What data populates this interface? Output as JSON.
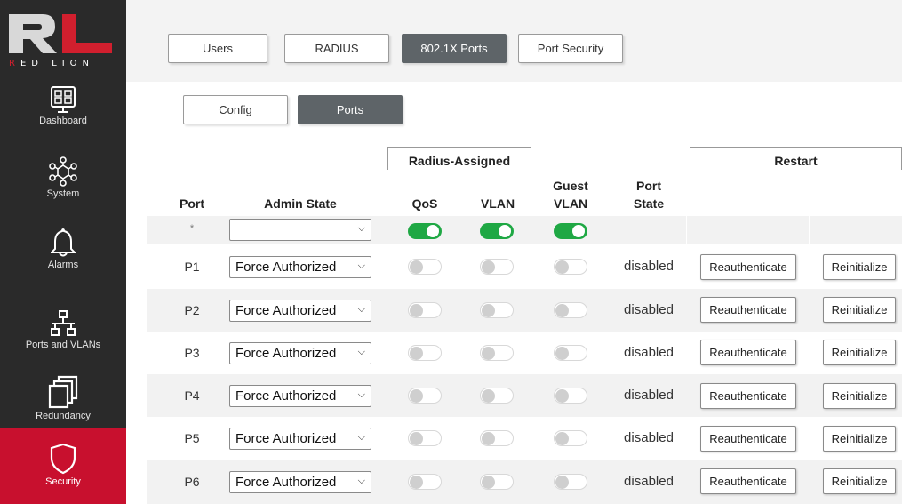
{
  "brand": {
    "logo_text": "RED LION",
    "accent": "#c8102e"
  },
  "sidebar": {
    "items": [
      {
        "label": "Dashboard",
        "icon": "dashboard-icon"
      },
      {
        "label": "System",
        "icon": "system-icon"
      },
      {
        "label": "Alarms",
        "icon": "bell-icon"
      },
      {
        "label": "Ports and VLANs",
        "icon": "network-icon"
      },
      {
        "label": "Redundancy",
        "icon": "redundancy-icon"
      },
      {
        "label": "Security",
        "icon": "shield-icon",
        "active": true
      }
    ]
  },
  "tabs": [
    {
      "label": "Users"
    },
    {
      "label": "RADIUS"
    },
    {
      "label": "802.1X Ports",
      "active": true
    },
    {
      "label": "Port Security"
    }
  ],
  "subtabs": [
    {
      "label": "Config"
    },
    {
      "label": "Ports",
      "active": true
    }
  ],
  "table": {
    "group_radius": "Radius-Assigned",
    "group_restart": "Restart",
    "columns": {
      "port": "Port",
      "admin_state": "Admin State",
      "qos": "QoS",
      "vlan": "VLAN",
      "guest_vlan_1": "Guest",
      "guest_vlan_2": "VLAN",
      "port_state_1": "Port",
      "port_state_2": "State"
    },
    "all_row": {
      "port": "*",
      "admin_state": "",
      "qos": true,
      "vlan": true,
      "guest_vlan": true
    },
    "rows": [
      {
        "port": "P1",
        "admin_state": "Force Authorized",
        "qos": false,
        "vlan": false,
        "guest_vlan": false,
        "state": "disabled",
        "reauth": "Reauthenticate",
        "reinit": "Reinitialize"
      },
      {
        "port": "P2",
        "admin_state": "Force Authorized",
        "qos": false,
        "vlan": false,
        "guest_vlan": false,
        "state": "disabled",
        "reauth": "Reauthenticate",
        "reinit": "Reinitialize"
      },
      {
        "port": "P3",
        "admin_state": "Force Authorized",
        "qos": false,
        "vlan": false,
        "guest_vlan": false,
        "state": "disabled",
        "reauth": "Reauthenticate",
        "reinit": "Reinitialize"
      },
      {
        "port": "P4",
        "admin_state": "Force Authorized",
        "qos": false,
        "vlan": false,
        "guest_vlan": false,
        "state": "disabled",
        "reauth": "Reauthenticate",
        "reinit": "Reinitialize"
      },
      {
        "port": "P5",
        "admin_state": "Force Authorized",
        "qos": false,
        "vlan": false,
        "guest_vlan": false,
        "state": "disabled",
        "reauth": "Reauthenticate",
        "reinit": "Reinitialize"
      },
      {
        "port": "P6",
        "admin_state": "Force Authorized",
        "qos": false,
        "vlan": false,
        "guest_vlan": false,
        "state": "disabled",
        "reauth": "Reauthenticate",
        "reinit": "Reinitialize"
      }
    ]
  }
}
